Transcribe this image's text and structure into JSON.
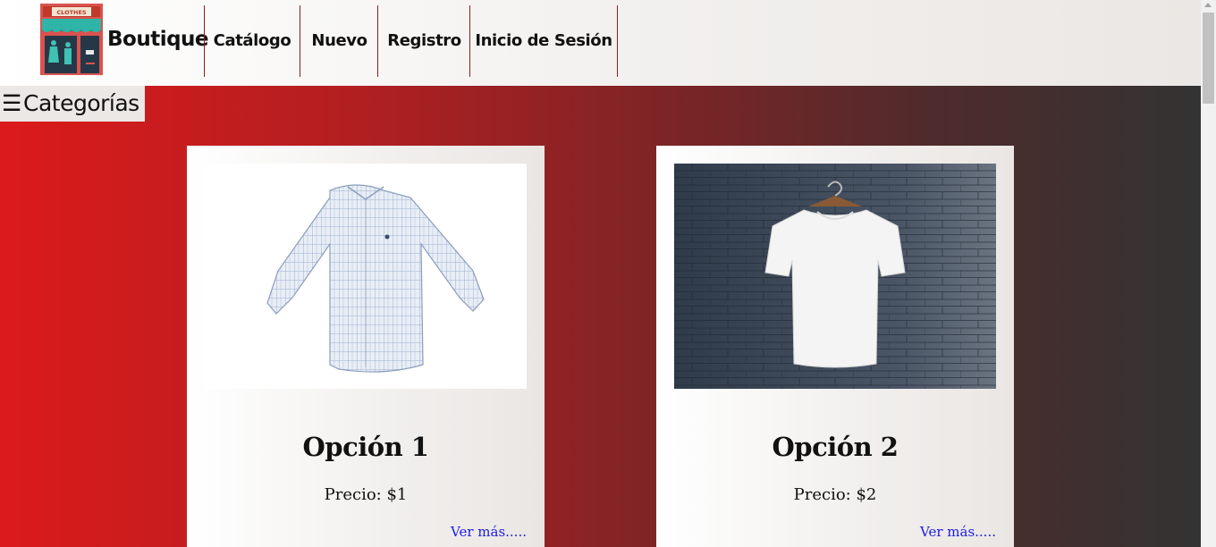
{
  "header": {
    "brand": "Boutique",
    "logo_icon": "clothes-store-icon",
    "logo_text": "CLOTHES",
    "nav": [
      {
        "label": "Catálogo"
      },
      {
        "label": "Nuevo"
      },
      {
        "label": "Registro"
      },
      {
        "label": "Inicio de Sesión"
      }
    ]
  },
  "categories": {
    "icon": "hamburger-menu-icon",
    "glyph": "☰",
    "label": "Categorías"
  },
  "products": [
    {
      "title": "Opción 1",
      "price": "Precio: $1",
      "link": "Ver más.....",
      "image": "plaid-shirt-image"
    },
    {
      "title": "Opción 2",
      "price": "Precio: $2",
      "link": "Ver más.....",
      "image": "white-tshirt-image"
    }
  ],
  "colors": {
    "nav_divider": "#8e1c22",
    "gradient_start": "#dc1a1b",
    "gradient_end": "#333333",
    "link": "#1b1be6"
  }
}
